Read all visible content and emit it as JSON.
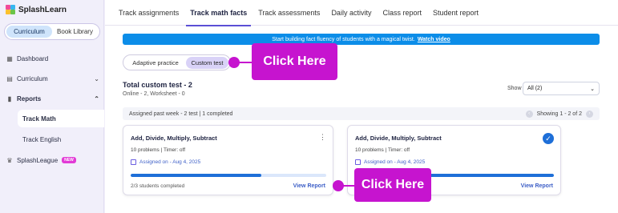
{
  "app": {
    "logo_text": "SplashLearn"
  },
  "sidebar": {
    "library_toggle": {
      "options": [
        "Curriculum",
        "Book Library"
      ],
      "selected": "Curriculum"
    },
    "items": [
      {
        "label": "Dashboard",
        "icon": "dashboard-icon"
      },
      {
        "label": "Curriculum",
        "icon": "curriculum-icon"
      },
      {
        "label": "Reports",
        "icon": "reports-icon"
      },
      {
        "label": "Track Math"
      },
      {
        "label": "Track English"
      },
      {
        "label": "SplashLeague",
        "icon": "trophy-icon",
        "badge": "NEW"
      }
    ]
  },
  "tabs": [
    "Track assignments",
    "Track math facts",
    "Track assessments",
    "Daily activity",
    "Class report",
    "Student report"
  ],
  "active_tab": "Track math facts",
  "banner": {
    "text": "Start building fact fluency of students with a magical twist.",
    "link": "Watch video"
  },
  "mode_toggle": {
    "options": [
      "Adaptive practice",
      "Custom test"
    ],
    "selected": "Custom test"
  },
  "callouts": [
    "Click Here",
    "Click Here"
  ],
  "summary": {
    "title": "Total custom test - 2",
    "subtitle": "Online - 2, Worksheet - 0",
    "show_label": "Show",
    "show_value": "All (2)",
    "assigned_text": "Assigned past week - 2 test | 1 completed",
    "showing_text": "Showing 1 - 2 of 2"
  },
  "cards": [
    {
      "title": "Add, Divide, Multiply, Subtract",
      "meta": "10 problems | Timer: off",
      "assigned": "Assigned on - Aug 4, 2025",
      "progress": 0.67,
      "completed": "2/3 students completed",
      "action": "View Report"
    },
    {
      "title": "Add, Divide, Multiply, Subtract",
      "meta": "10 problems | Timer: off",
      "assigned": "Assigned on - Aug 4, 2025",
      "progress": 1.0,
      "completed": "",
      "action": "View Report"
    }
  ],
  "colors": {
    "accent": "#5b4fd6",
    "callout": "#c614cf",
    "banner": "#0c8de8",
    "progress": "#1e6fd8"
  }
}
